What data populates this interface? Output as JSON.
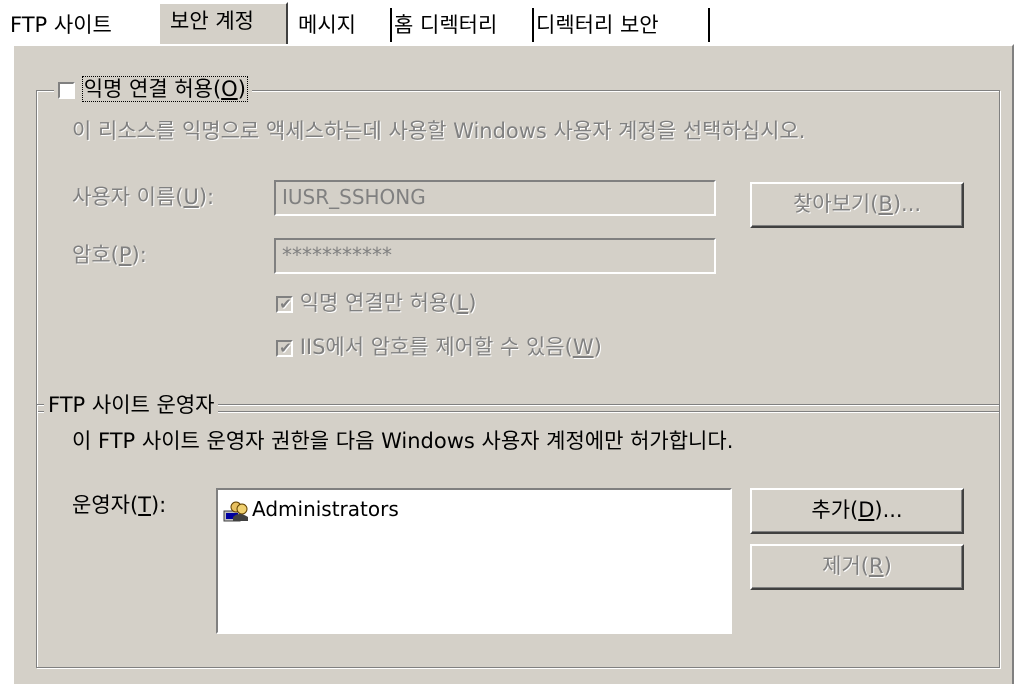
{
  "tabs": [
    {
      "label": "FTP 사이트",
      "active": false
    },
    {
      "label": "보안 계정",
      "active": true
    },
    {
      "label": "메시지",
      "active": false
    },
    {
      "label": "홈 디렉터리",
      "active": false
    },
    {
      "label": "디렉터리 보안",
      "active": false
    }
  ],
  "anonymous": {
    "checkbox_label_prefix": "익명 연결 허용(",
    "checkbox_label_key": "O",
    "checkbox_label_suffix": ")",
    "checked": false,
    "description": "이 리소스를 익명으로 액세스하는데 사용할 Windows 사용자 계정을 선택하십시오.",
    "username_label_prefix": "사용자 이름(",
    "username_label_key": "U",
    "username_label_suffix": "):",
    "username_value": "IUSR_SSHONG",
    "browse_prefix": "찾아보기(",
    "browse_key": "B",
    "browse_suffix": ")...",
    "password_label_prefix": "암호(",
    "password_label_key": "P",
    "password_label_suffix": "):",
    "password_value": "***********",
    "only_anon_prefix": "익명 연결만 허용(",
    "only_anon_key": "L",
    "only_anon_suffix": ")",
    "only_anon_checked": true,
    "iis_pw_prefix": "IIS에서 암호를 제어할 수 있음(",
    "iis_pw_key": "W",
    "iis_pw_suffix": ")",
    "iis_pw_checked": true
  },
  "operators": {
    "group_title": "FTP 사이트 운영자",
    "description": "이 FTP 사이트 운영자 권한을 다음 Windows 사용자 계정에만 허가합니다.",
    "label_prefix": "운영자(",
    "label_key": "T",
    "label_suffix": "):",
    "items": [
      "Administrators"
    ],
    "add_prefix": "추가(",
    "add_key": "D",
    "add_suffix": ")...",
    "remove_prefix": "제거(",
    "remove_key": "R",
    "remove_suffix": ")"
  },
  "check_mark": "✔",
  "icons": {
    "group_icon": "users-group-icon",
    "check_icon": "checkmark-icon"
  }
}
